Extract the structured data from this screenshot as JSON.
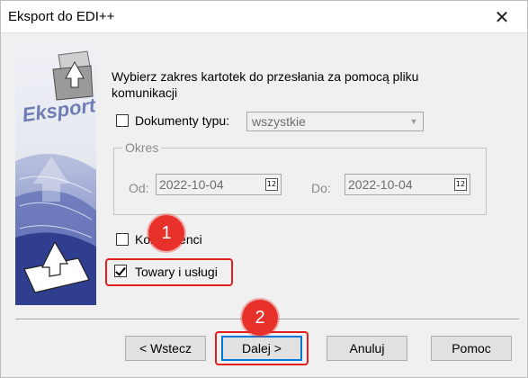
{
  "window": {
    "title": "Eksport do EDI++",
    "close_glyph": "✕"
  },
  "banner": {
    "label": "Eksport",
    "icon": "export-wizard-graphic"
  },
  "intro": {
    "text": "Wybierz zakres kartotek do przesłania za pomocą pliku komunikacji"
  },
  "documents": {
    "label": "Dokumenty typu:",
    "checked": false,
    "select_value": "wszystkie"
  },
  "period": {
    "legend": "Okres",
    "from_label": "Od:",
    "from_value": "2022-10-04",
    "to_label": "Do:",
    "to_value": "2022-10-04",
    "calendar_glyph": "12"
  },
  "contractors": {
    "label": "Kontrahenci",
    "checked": false
  },
  "goods": {
    "label": "Towary i usługi",
    "checked": true
  },
  "annotations": {
    "badge1": "1",
    "badge2": "2",
    "color": "#e01f1f"
  },
  "buttons": {
    "back": "< Wstecz",
    "next": "Dalej >",
    "cancel": "Anuluj",
    "help": "Pomoc"
  }
}
